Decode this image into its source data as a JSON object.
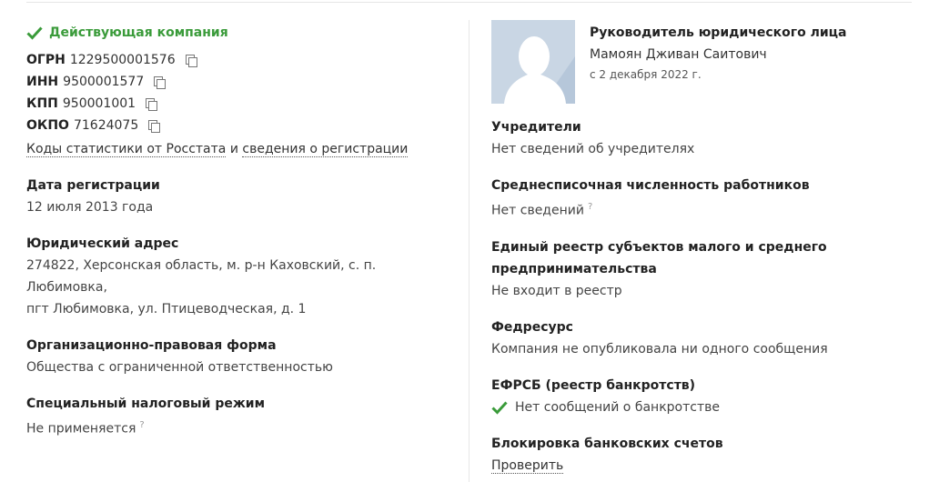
{
  "colors": {
    "accent_green": "#3a9b3a",
    "avatar_bg": "#c9d6e4"
  },
  "status": {
    "label": "Действующая компания",
    "icon": "check-icon"
  },
  "codes": [
    {
      "key": "ОГРН",
      "value": "1229500001576"
    },
    {
      "key": "ИНН",
      "value": "9500001577"
    },
    {
      "key": "КПП",
      "value": "950001001"
    },
    {
      "key": "ОКПО",
      "value": "71624075"
    }
  ],
  "links": {
    "rosstat": "Коды статистики от Росстата",
    "and": "и",
    "registration": "сведения о регистрации"
  },
  "registration": {
    "label": "Дата регистрации",
    "value": "12 июля 2013 года"
  },
  "address": {
    "label": "Юридический адрес",
    "line1": "274822, Херсонская область, м. р-н Каховский, с. п. Любимовка,",
    "line2": "пгт Любимовка, ул. Птицеводческая, д. 1"
  },
  "legal_form": {
    "label": "Организационно-правовая форма",
    "value": "Общества с ограниченной ответственностью"
  },
  "tax_regime": {
    "label": "Специальный налоговый режим",
    "value": "Не применяется",
    "hint": "?"
  },
  "head": {
    "title": "Руководитель юридического лица",
    "name": "Мамоян Дживан Саитович",
    "since": "с 2 декабря 2022 г."
  },
  "founders": {
    "label": "Учредители",
    "value": "Нет сведений об учредителях"
  },
  "employees": {
    "label": "Среднесписочная численность работников",
    "value": "Нет сведений",
    "hint": "?"
  },
  "sme": {
    "label_line1": "Единый реестр субъектов малого и среднего",
    "label_line2": "предпринимательства",
    "value": "Не входит в реестр"
  },
  "fedresurs": {
    "label": "Федресурс",
    "value": "Компания не опубликовала ни одного сообщения"
  },
  "efrsb": {
    "label": "ЕФРСБ (реестр банкротств)",
    "value": "Нет сообщений о банкротстве"
  },
  "bank_block": {
    "label": "Блокировка банковских счетов",
    "link": "Проверить"
  }
}
